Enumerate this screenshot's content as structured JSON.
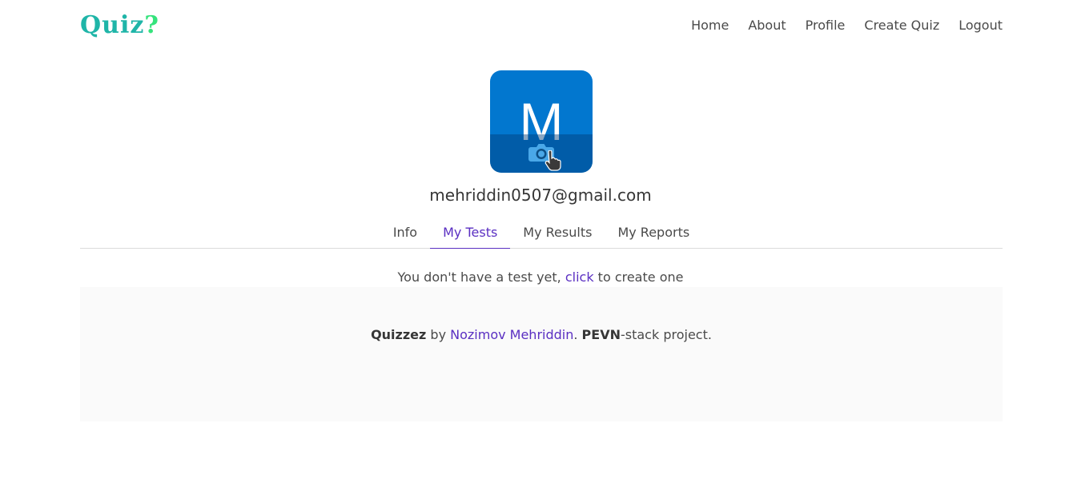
{
  "logo": {
    "part1": "Quiz",
    "part2": "?"
  },
  "nav": {
    "home": "Home",
    "about": "About",
    "profile": "Profile",
    "create_quiz": "Create Quiz",
    "logout": "Logout"
  },
  "profile": {
    "avatar_letter": "M",
    "email": "mehriddin0507@gmail.com"
  },
  "tabs": {
    "info": "Info",
    "my_tests": "My Tests",
    "my_results": "My Results",
    "my_reports": "My Reports",
    "active": "My Tests"
  },
  "empty_state": {
    "text_before": "You don't have a test yet, ",
    "link": "click",
    "text_after": " to create one"
  },
  "footer": {
    "brand": "Quizzez",
    "by": " by ",
    "author": "Nozimov Mehriddin",
    "sep": ". ",
    "stack": "PEVN",
    "suffix": "-stack project."
  },
  "colors": {
    "accent": "#5a2fc2",
    "avatar_bg": "#0277cf",
    "logo_teal": "#1fb5a8",
    "logo_green": "#35e37c"
  },
  "icons": {
    "avatar_upload": "camera-icon",
    "pointer": "hand-cursor-icon"
  }
}
